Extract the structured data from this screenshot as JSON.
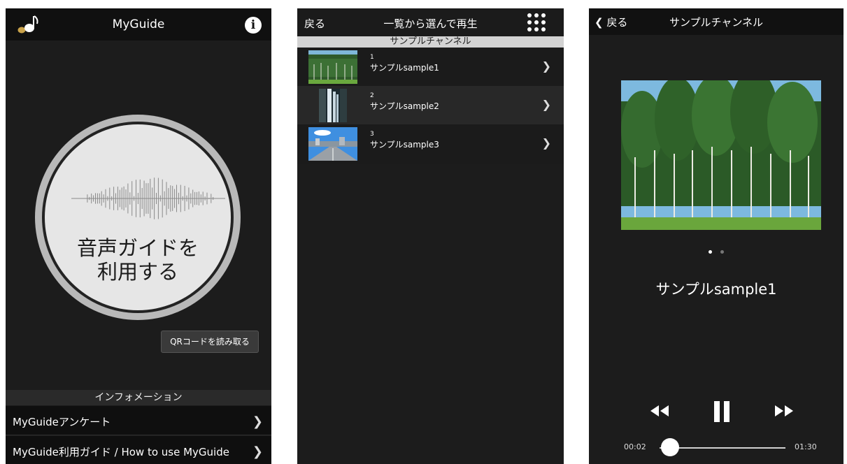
{
  "screen1": {
    "title": "MyGuide",
    "guide_button_lines": [
      "音声ガイドを",
      "利用する"
    ],
    "qr_button": "QRコードを読み取る",
    "info_header": "インフォメーション",
    "info_items": [
      {
        "label": "MyGuideアンケート"
      },
      {
        "label": "MyGuide利用ガイド / How to use MyGuide"
      }
    ],
    "icons": [
      "music-note-icon",
      "info-icon",
      "chevron-right-icon",
      "waveform-icon"
    ]
  },
  "screen2": {
    "back_label": "戻る",
    "title": "一覧から選んで再生",
    "section_header": "サンプルチャンネル",
    "items": [
      {
        "number": "1",
        "name": "サンプルsample1",
        "thumb": "forest"
      },
      {
        "number": "2",
        "name": "サンプルsample2",
        "thumb": "waterfall"
      },
      {
        "number": "3",
        "name": "サンプルsample3",
        "thumb": "road"
      }
    ],
    "icons": [
      "grid-dots-icon",
      "chevron-right-icon"
    ]
  },
  "screen3": {
    "back_label": "戻る",
    "title": "サンプルチャンネル",
    "track_title": "サンプルsample1",
    "page_indicator": {
      "count": 2,
      "current": 1
    },
    "time_current": "00:02",
    "time_total": "01:30",
    "progress_fraction": 0.02,
    "icons": [
      "chevron-left-icon",
      "rewind-icon",
      "pause-icon",
      "fast-forward-icon"
    ]
  },
  "colors": {
    "screen_bg": "#1c1c1c",
    "bar_bg": "#101010",
    "accent_gold": "#c9a24a",
    "circle_ring": "#b9b9b9",
    "circle_face": "#e6e6e6"
  }
}
